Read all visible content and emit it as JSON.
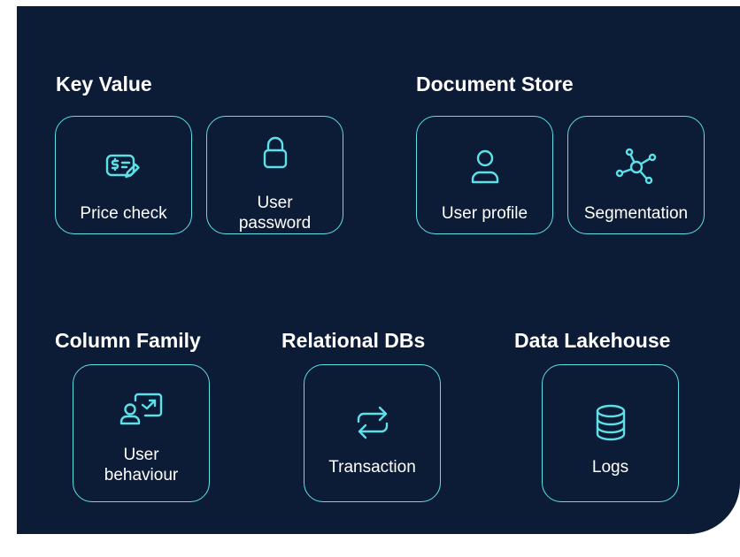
{
  "colors": {
    "background": "#0d1c36",
    "accent": "#5ee0e9",
    "text": "#ffffff"
  },
  "groups": [
    {
      "title": "Key Value",
      "items": [
        {
          "label": "Price check",
          "icon": "price-tag-icon"
        },
        {
          "label": "User\npassword",
          "icon": "lock-icon"
        }
      ]
    },
    {
      "title": "Document Store",
      "items": [
        {
          "label": "User profile",
          "icon": "user-icon"
        },
        {
          "label": "Segmentation",
          "icon": "network-icon"
        }
      ]
    },
    {
      "title": "Column Family",
      "items": [
        {
          "label": "User\nbehaviour",
          "icon": "user-chart-icon"
        }
      ]
    },
    {
      "title": "Relational DBs",
      "items": [
        {
          "label": "Transaction",
          "icon": "exchange-icon"
        }
      ]
    },
    {
      "title": "Data Lakehouse",
      "items": [
        {
          "label": "Logs",
          "icon": "database-icon"
        }
      ]
    }
  ]
}
